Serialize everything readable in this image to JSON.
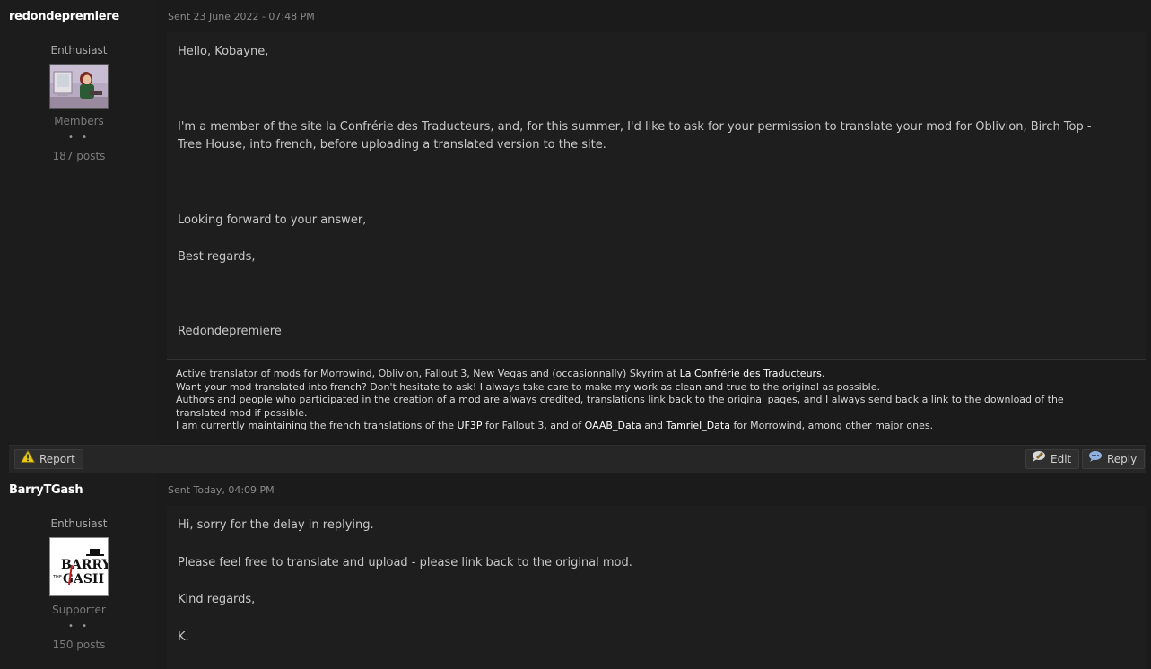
{
  "posts": [
    {
      "author": "redondepremiere",
      "member_title": "Enthusiast",
      "group": "Members",
      "pips": "• •",
      "posts_count": "187 posts",
      "date": "Sent 23 June 2022 - 07:48 PM",
      "body": [
        "Hello, Kobayne,",
        "I'm a member of the site la Confrérie des Traducteurs, and, for this summer, I'd like to ask for your permission to translate your mod for Oblivion, Birch Top - Tree House, into french, before uploading a translated version to the site.",
        "Looking forward to your answer,",
        "Best regards,",
        "Redondepremiere"
      ],
      "signature": {
        "line1_text": "Active translator of mods for Morrowind, Oblivion, Fallout 3, New Vegas and (occasionnally) Skyrim  at ",
        "line1_link": "La Confrérie des Traducteurs",
        "line1_end": ".",
        "line2": "Want your mod translated into french? Don't hesitate to ask! I always take care to make my work as clean and true to the original as possible.",
        "line3": "Authors and people who participated in the creation of a mod are always credited, translations link back to the original pages, and I always send back a link to the download of the translated mod if possible.",
        "line4_a": "I am currently maintaining the french translations of the ",
        "line4_link1": "UF3P",
        "line4_b": " for Fallout 3, and of ",
        "line4_link2": "OAAB_Data",
        "line4_c": " and ",
        "line4_link3": "Tamriel_Data",
        "line4_d": " for Morrowind, among other major ones."
      },
      "buttons": {
        "report": "Report",
        "edit": "Edit",
        "reply": "Reply"
      }
    },
    {
      "author": "BarryTGash",
      "member_title": "Enthusiast",
      "group": "Supporter",
      "pips": "• •",
      "posts_count": "150 posts",
      "date": "Sent Today, 04:09 PM",
      "avatar_text": {
        "top": "BARRY",
        "bottom": "GASH",
        "small": "THE"
      },
      "body": [
        "Hi, sorry for the delay in replying.",
        "Please feel free to translate and upload - please link back to the original mod.",
        "Kind regards,",
        "K."
      ]
    }
  ],
  "colors": {
    "background": "#1b1b1b",
    "text": "#c8c8c8",
    "username": "#ffffff",
    "link": "#ffffff",
    "report_icon": "#e6c619"
  },
  "icons": {
    "report": "warning-triangle-icon",
    "edit": "speech-bubble-pencil-icon",
    "reply": "speech-bubble-icon"
  }
}
